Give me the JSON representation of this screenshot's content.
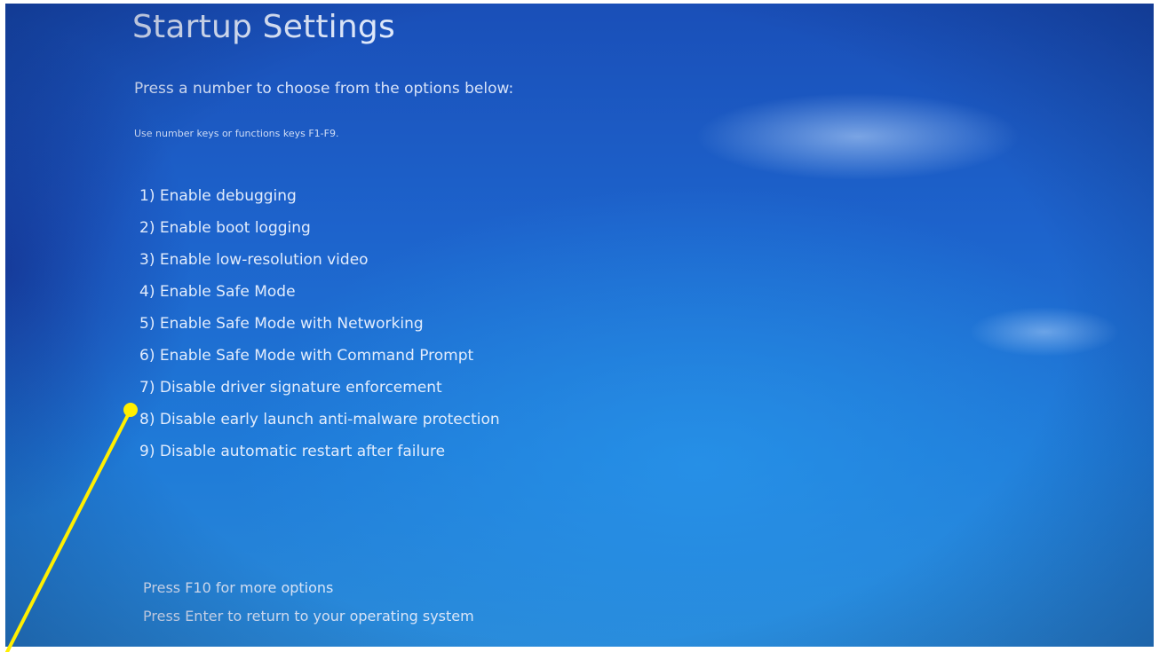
{
  "screen": {
    "title": "Startup Settings",
    "instructions": "Press a number to choose from the options below:",
    "hint": "Use number keys or functions keys F1-F9."
  },
  "options": [
    {
      "label": "1) Enable debugging"
    },
    {
      "label": "2) Enable boot logging"
    },
    {
      "label": "3) Enable low-resolution video"
    },
    {
      "label": "4) Enable Safe Mode"
    },
    {
      "label": "5) Enable Safe Mode with Networking"
    },
    {
      "label": "6) Enable Safe Mode with Command Prompt"
    },
    {
      "label": "7) Disable driver signature enforcement"
    },
    {
      "label": "8) Disable early launch anti-malware protection"
    },
    {
      "label": "9) Disable automatic restart after failure"
    }
  ],
  "footer": {
    "more_options": "Press F10 for more options",
    "return": "Press Enter to return to your operating system"
  },
  "annotation": {
    "color": "#ffef00",
    "points_to": "8) Disable early launch anti-malware protection"
  }
}
